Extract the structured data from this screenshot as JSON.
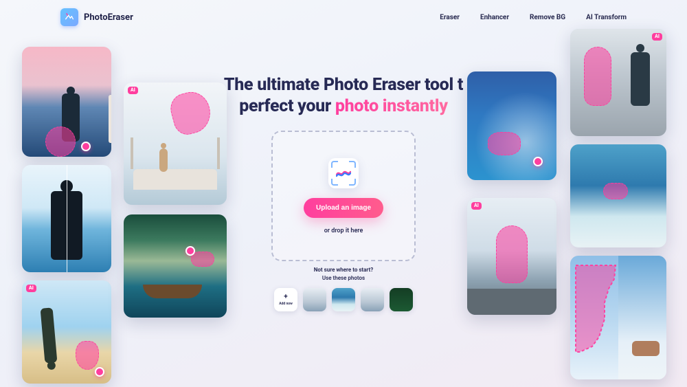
{
  "brand": {
    "name": "PhotoEraser"
  },
  "nav": {
    "eraser": "Eraser",
    "enhancer": "Enhancer",
    "remove_bg": "Remove BG",
    "ai_transform": "AI Transform"
  },
  "hero": {
    "line1": "The ultimate Photo Eraser tool t",
    "line2_a": "perfect your ",
    "line2_b": "photo instantly"
  },
  "upload": {
    "button": "Upload an image",
    "sub": "or drop it here"
  },
  "suggest": {
    "line1": "Not sure where to start?",
    "line2": "Use these photos",
    "add_label": "Add now"
  },
  "badges": {
    "ai": "AI"
  },
  "colors": {
    "accent": "#ff3e9e",
    "text": "#272a55"
  }
}
